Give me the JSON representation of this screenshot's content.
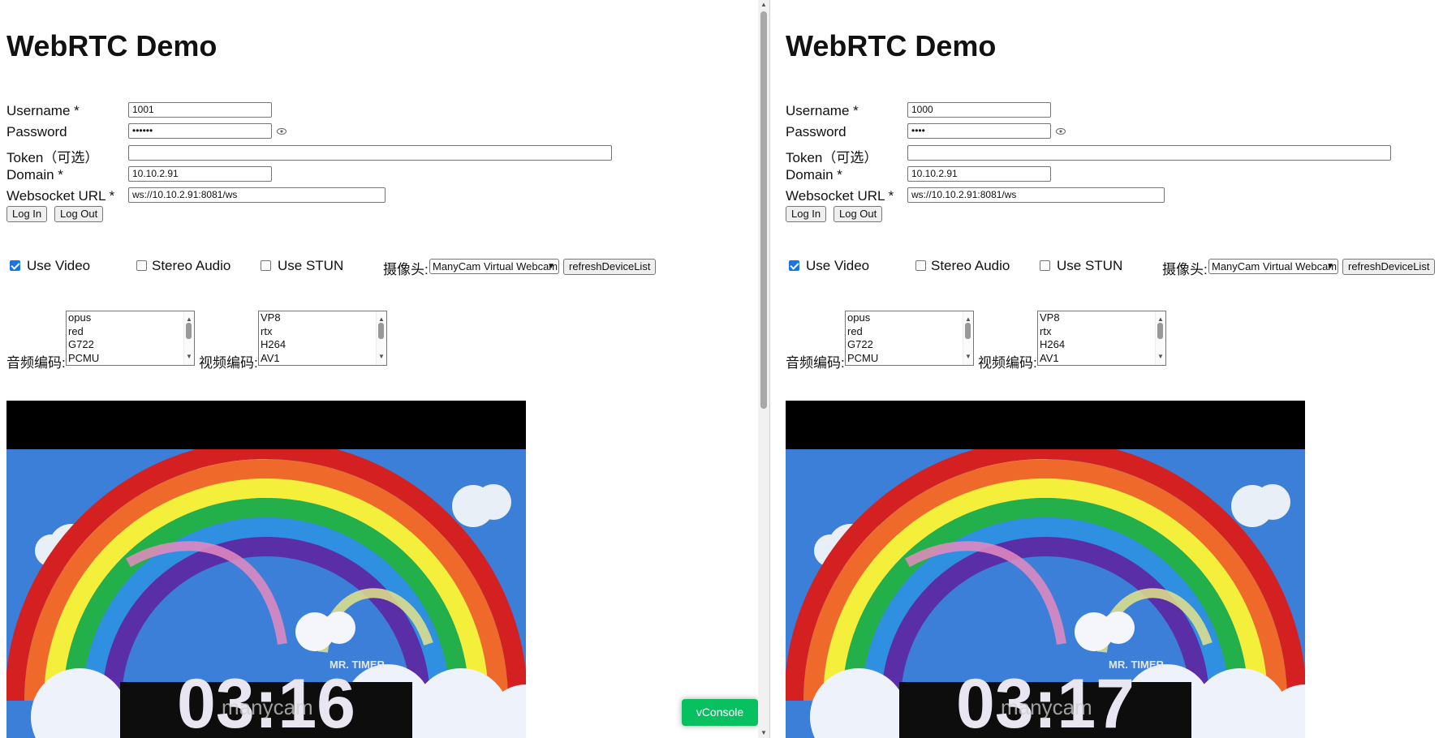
{
  "left": {
    "title": "WebRTC Demo",
    "username_label": "Username *",
    "username_value": "1001",
    "password_label": "Password",
    "password_value": "••••••",
    "token_label": "Token（可选）",
    "token_value": "",
    "domain_label": "Domain *",
    "domain_value": "10.10.2.91",
    "ws_label": "Websocket URL *",
    "ws_value": "ws://10.10.2.91:8081/ws",
    "login_label": "Log In",
    "logout_label": "Log Out",
    "use_video_label": "Use Video",
    "use_video_checked": true,
    "stereo_label": "Stereo Audio",
    "stun_label": "Use STUN",
    "camera_label": "摄像头:",
    "camera_value": "ManyCam Virtual Webcam",
    "refresh_label": "refreshDeviceList",
    "audio_codec_label": "音频编码:",
    "audio_codecs": [
      "opus",
      "red",
      "G722",
      "PCMU"
    ],
    "video_codec_label": "视频编码:",
    "video_codecs": [
      "VP8",
      "rtx",
      "H264",
      "AV1"
    ],
    "video_timer": "03:16",
    "video_watermark": "manycam",
    "video_credit": "MR. TIMER"
  },
  "right": {
    "title": "WebRTC Demo",
    "username_label": "Username *",
    "username_value": "1000",
    "password_label": "Password",
    "password_value": "••••",
    "token_label": "Token（可选）",
    "token_value": "",
    "domain_label": "Domain *",
    "domain_value": "10.10.2.91",
    "ws_label": "Websocket URL *",
    "ws_value": "ws://10.10.2.91:8081/ws",
    "login_label": "Log In",
    "logout_label": "Log Out",
    "use_video_label": "Use Video",
    "use_video_checked": true,
    "stereo_label": "Stereo Audio",
    "stun_label": "Use STUN",
    "camera_label": "摄像头:",
    "camera_value": "ManyCam Virtual Webcam",
    "refresh_label": "refreshDeviceList",
    "audio_codec_label": "音频编码:",
    "audio_codecs": [
      "opus",
      "red",
      "G722",
      "PCMU"
    ],
    "video_codec_label": "视频编码:",
    "video_codecs": [
      "VP8",
      "rtx",
      "H264",
      "AV1"
    ],
    "video_timer": "03:17",
    "video_watermark": "manycam",
    "video_credit": "MR. TIMER"
  },
  "vconsole_label": "vConsole",
  "icons": {
    "password_toggle": "eye-icon",
    "select_caret": "chevron-down-icon",
    "checkbox_mark": "checkmark-icon"
  },
  "colors": {
    "checkbox_accent": "#1a73e8",
    "vconsole_bg": "#07c160",
    "video_background": "#000000",
    "sky": "#3b7fd8"
  }
}
